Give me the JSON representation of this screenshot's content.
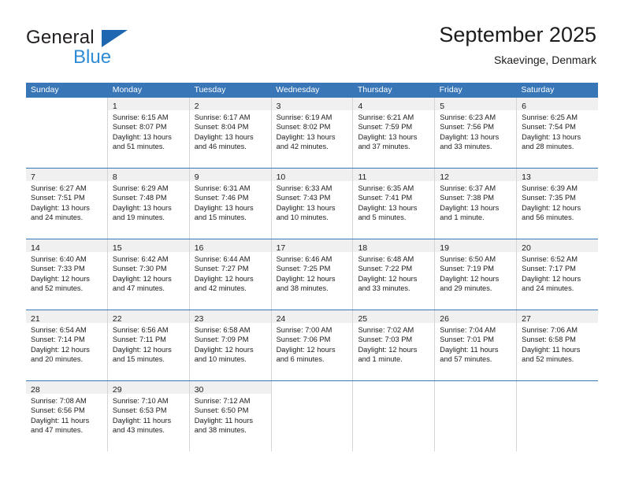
{
  "brand": {
    "name_part1": "General",
    "name_part2": "Blue",
    "triangle_color": "#1f66b0",
    "blue_color": "#2e8bd4"
  },
  "header": {
    "title": "September 2025",
    "subtitle": "Skaevinge, Denmark"
  },
  "theme": {
    "header_row_bg": "#3876b8",
    "header_row_text": "#ffffff",
    "daynum_band_bg": "#f0f0f0",
    "cell_border": "#d4d4d4",
    "week_divider": "#3876b8"
  },
  "weekdays": [
    "Sunday",
    "Monday",
    "Tuesday",
    "Wednesday",
    "Thursday",
    "Friday",
    "Saturday"
  ],
  "labels": {
    "sunrise_prefix": "Sunrise:",
    "sunset_prefix": "Sunset:",
    "daylight_prefix": "Daylight:"
  },
  "weeks": [
    [
      {
        "day": "",
        "sunrise": "",
        "sunset": "",
        "daylight_line1": "",
        "daylight_line2": ""
      },
      {
        "day": "1",
        "sunrise": "Sunrise: 6:15 AM",
        "sunset": "Sunset: 8:07 PM",
        "daylight_line1": "Daylight: 13 hours",
        "daylight_line2": "and 51 minutes."
      },
      {
        "day": "2",
        "sunrise": "Sunrise: 6:17 AM",
        "sunset": "Sunset: 8:04 PM",
        "daylight_line1": "Daylight: 13 hours",
        "daylight_line2": "and 46 minutes."
      },
      {
        "day": "3",
        "sunrise": "Sunrise: 6:19 AM",
        "sunset": "Sunset: 8:02 PM",
        "daylight_line1": "Daylight: 13 hours",
        "daylight_line2": "and 42 minutes."
      },
      {
        "day": "4",
        "sunrise": "Sunrise: 6:21 AM",
        "sunset": "Sunset: 7:59 PM",
        "daylight_line1": "Daylight: 13 hours",
        "daylight_line2": "and 37 minutes."
      },
      {
        "day": "5",
        "sunrise": "Sunrise: 6:23 AM",
        "sunset": "Sunset: 7:56 PM",
        "daylight_line1": "Daylight: 13 hours",
        "daylight_line2": "and 33 minutes."
      },
      {
        "day": "6",
        "sunrise": "Sunrise: 6:25 AM",
        "sunset": "Sunset: 7:54 PM",
        "daylight_line1": "Daylight: 13 hours",
        "daylight_line2": "and 28 minutes."
      }
    ],
    [
      {
        "day": "7",
        "sunrise": "Sunrise: 6:27 AM",
        "sunset": "Sunset: 7:51 PM",
        "daylight_line1": "Daylight: 13 hours",
        "daylight_line2": "and 24 minutes."
      },
      {
        "day": "8",
        "sunrise": "Sunrise: 6:29 AM",
        "sunset": "Sunset: 7:48 PM",
        "daylight_line1": "Daylight: 13 hours",
        "daylight_line2": "and 19 minutes."
      },
      {
        "day": "9",
        "sunrise": "Sunrise: 6:31 AM",
        "sunset": "Sunset: 7:46 PM",
        "daylight_line1": "Daylight: 13 hours",
        "daylight_line2": "and 15 minutes."
      },
      {
        "day": "10",
        "sunrise": "Sunrise: 6:33 AM",
        "sunset": "Sunset: 7:43 PM",
        "daylight_line1": "Daylight: 13 hours",
        "daylight_line2": "and 10 minutes."
      },
      {
        "day": "11",
        "sunrise": "Sunrise: 6:35 AM",
        "sunset": "Sunset: 7:41 PM",
        "daylight_line1": "Daylight: 13 hours",
        "daylight_line2": "and 5 minutes."
      },
      {
        "day": "12",
        "sunrise": "Sunrise: 6:37 AM",
        "sunset": "Sunset: 7:38 PM",
        "daylight_line1": "Daylight: 13 hours",
        "daylight_line2": "and 1 minute."
      },
      {
        "day": "13",
        "sunrise": "Sunrise: 6:39 AM",
        "sunset": "Sunset: 7:35 PM",
        "daylight_line1": "Daylight: 12 hours",
        "daylight_line2": "and 56 minutes."
      }
    ],
    [
      {
        "day": "14",
        "sunrise": "Sunrise: 6:40 AM",
        "sunset": "Sunset: 7:33 PM",
        "daylight_line1": "Daylight: 12 hours",
        "daylight_line2": "and 52 minutes."
      },
      {
        "day": "15",
        "sunrise": "Sunrise: 6:42 AM",
        "sunset": "Sunset: 7:30 PM",
        "daylight_line1": "Daylight: 12 hours",
        "daylight_line2": "and 47 minutes."
      },
      {
        "day": "16",
        "sunrise": "Sunrise: 6:44 AM",
        "sunset": "Sunset: 7:27 PM",
        "daylight_line1": "Daylight: 12 hours",
        "daylight_line2": "and 42 minutes."
      },
      {
        "day": "17",
        "sunrise": "Sunrise: 6:46 AM",
        "sunset": "Sunset: 7:25 PM",
        "daylight_line1": "Daylight: 12 hours",
        "daylight_line2": "and 38 minutes."
      },
      {
        "day": "18",
        "sunrise": "Sunrise: 6:48 AM",
        "sunset": "Sunset: 7:22 PM",
        "daylight_line1": "Daylight: 12 hours",
        "daylight_line2": "and 33 minutes."
      },
      {
        "day": "19",
        "sunrise": "Sunrise: 6:50 AM",
        "sunset": "Sunset: 7:19 PM",
        "daylight_line1": "Daylight: 12 hours",
        "daylight_line2": "and 29 minutes."
      },
      {
        "day": "20",
        "sunrise": "Sunrise: 6:52 AM",
        "sunset": "Sunset: 7:17 PM",
        "daylight_line1": "Daylight: 12 hours",
        "daylight_line2": "and 24 minutes."
      }
    ],
    [
      {
        "day": "21",
        "sunrise": "Sunrise: 6:54 AM",
        "sunset": "Sunset: 7:14 PM",
        "daylight_line1": "Daylight: 12 hours",
        "daylight_line2": "and 20 minutes."
      },
      {
        "day": "22",
        "sunrise": "Sunrise: 6:56 AM",
        "sunset": "Sunset: 7:11 PM",
        "daylight_line1": "Daylight: 12 hours",
        "daylight_line2": "and 15 minutes."
      },
      {
        "day": "23",
        "sunrise": "Sunrise: 6:58 AM",
        "sunset": "Sunset: 7:09 PM",
        "daylight_line1": "Daylight: 12 hours",
        "daylight_line2": "and 10 minutes."
      },
      {
        "day": "24",
        "sunrise": "Sunrise: 7:00 AM",
        "sunset": "Sunset: 7:06 PM",
        "daylight_line1": "Daylight: 12 hours",
        "daylight_line2": "and 6 minutes."
      },
      {
        "day": "25",
        "sunrise": "Sunrise: 7:02 AM",
        "sunset": "Sunset: 7:03 PM",
        "daylight_line1": "Daylight: 12 hours",
        "daylight_line2": "and 1 minute."
      },
      {
        "day": "26",
        "sunrise": "Sunrise: 7:04 AM",
        "sunset": "Sunset: 7:01 PM",
        "daylight_line1": "Daylight: 11 hours",
        "daylight_line2": "and 57 minutes."
      },
      {
        "day": "27",
        "sunrise": "Sunrise: 7:06 AM",
        "sunset": "Sunset: 6:58 PM",
        "daylight_line1": "Daylight: 11 hours",
        "daylight_line2": "and 52 minutes."
      }
    ],
    [
      {
        "day": "28",
        "sunrise": "Sunrise: 7:08 AM",
        "sunset": "Sunset: 6:56 PM",
        "daylight_line1": "Daylight: 11 hours",
        "daylight_line2": "and 47 minutes."
      },
      {
        "day": "29",
        "sunrise": "Sunrise: 7:10 AM",
        "sunset": "Sunset: 6:53 PM",
        "daylight_line1": "Daylight: 11 hours",
        "daylight_line2": "and 43 minutes."
      },
      {
        "day": "30",
        "sunrise": "Sunrise: 7:12 AM",
        "sunset": "Sunset: 6:50 PM",
        "daylight_line1": "Daylight: 11 hours",
        "daylight_line2": "and 38 minutes."
      },
      {
        "day": "",
        "sunrise": "",
        "sunset": "",
        "daylight_line1": "",
        "daylight_line2": ""
      },
      {
        "day": "",
        "sunrise": "",
        "sunset": "",
        "daylight_line1": "",
        "daylight_line2": ""
      },
      {
        "day": "",
        "sunrise": "",
        "sunset": "",
        "daylight_line1": "",
        "daylight_line2": ""
      },
      {
        "day": "",
        "sunrise": "",
        "sunset": "",
        "daylight_line1": "",
        "daylight_line2": ""
      }
    ]
  ]
}
